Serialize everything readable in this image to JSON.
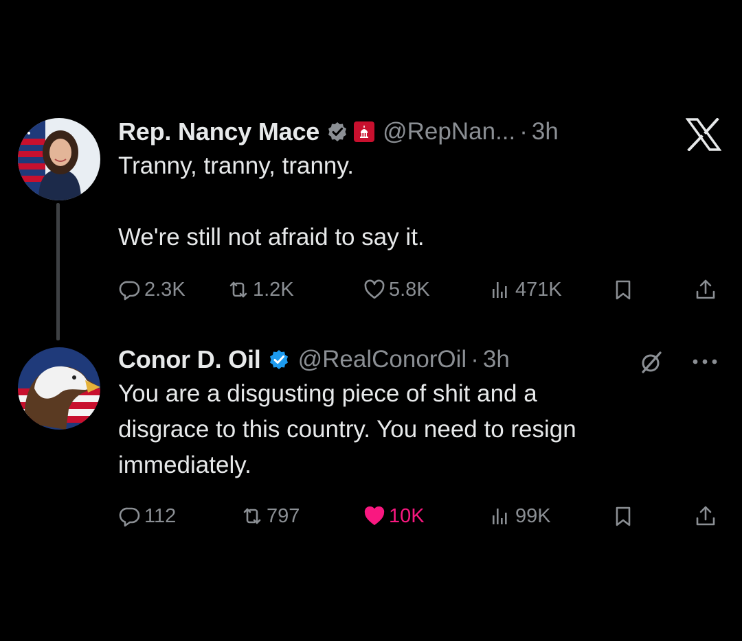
{
  "tweets": [
    {
      "display_name": "Rep. Nancy Mace",
      "handle": "@RepNan...",
      "separator": "·",
      "time": "3h",
      "verified": true,
      "government_badge": true,
      "text": "Tranny, tranny, tranny.\n\nWe're still not afraid to say it.",
      "actions": {
        "replies": "2.3K",
        "reposts": "1.2K",
        "likes": "5.8K",
        "views": "471K"
      },
      "liked": false
    },
    {
      "display_name": "Conor D. Oil",
      "handle": "@RealConorOil",
      "separator": "·",
      "time": "3h",
      "verified": true,
      "text": "You are a disgusting piece of shit and a\ndisgrace to this country. You need to resign\nimmediately.",
      "actions": {
        "replies": "112",
        "reposts": "797",
        "likes": "10K",
        "views": "99K"
      },
      "liked": true
    }
  ],
  "colors": {
    "background": "#000000",
    "text": "#e7e9ea",
    "secondary": "#8b8f94",
    "verified": "#1d9bf0",
    "like_active": "#f91880",
    "government": "#c8102e"
  },
  "icons": {
    "app_logo": "x-logo-icon",
    "reply": "reply-icon",
    "repost": "repost-icon",
    "like": "heart-icon",
    "views": "views-icon",
    "bookmark": "bookmark-icon",
    "share": "share-icon",
    "grok": "grok-icon",
    "more": "more-icon"
  }
}
